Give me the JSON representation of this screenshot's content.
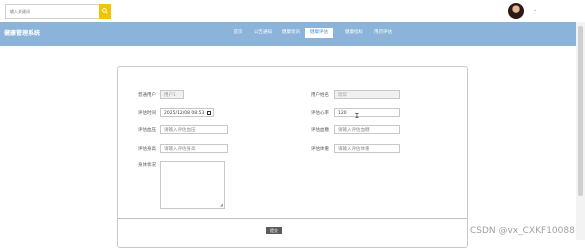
{
  "search": {
    "placeholder": "输入关键词"
  },
  "brand": "健康管理系统",
  "nav": [
    {
      "label": "首页",
      "active": false
    },
    {
      "label": "公告通知",
      "active": false
    },
    {
      "label": "健康资讯",
      "active": false
    },
    {
      "label": "健康评估",
      "active": true
    },
    {
      "label": "健康指标",
      "active": false
    },
    {
      "label": "用药评估",
      "active": false
    }
  ],
  "form": {
    "user_account": {
      "label": "普通用户",
      "value": "用户1"
    },
    "user_name": {
      "label": "用户姓名",
      "value": "玩华"
    },
    "eval_time": {
      "label": "评估时间",
      "value": "2025/12/08 08:53"
    },
    "eval_heart": {
      "label": "评估心率",
      "value": "120"
    },
    "eval_bp": {
      "label": "评估血压",
      "placeholder": "请输入评估血压"
    },
    "eval_sugar": {
      "label": "评估血糖",
      "placeholder": "请输入评估血糖"
    },
    "eval_fat": {
      "label": "评估身高",
      "placeholder": "请输入评估身高"
    },
    "eval_weight": {
      "label": "评估体重",
      "placeholder": "请输入评估体重"
    },
    "body_status": {
      "label": "身体状况"
    },
    "submit_label": "提交"
  },
  "watermark": "CSDN @vx_CXKF10088"
}
